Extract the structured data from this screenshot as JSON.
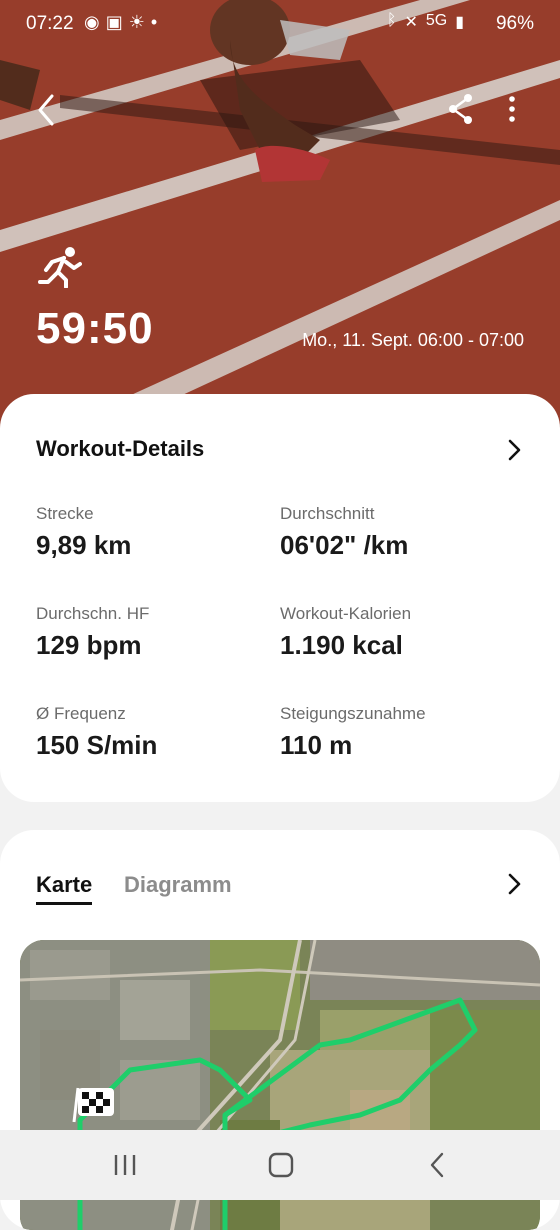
{
  "status_bar": {
    "time": "07:22",
    "battery": "96%",
    "left_icons": [
      "whatsapp-icon",
      "image-icon",
      "weather-icon",
      "dot-icon"
    ],
    "right_icons": [
      "bluetooth-icon",
      "mute-icon",
      "5g-icon",
      "signal-icon"
    ]
  },
  "hero": {
    "duration": "59:50",
    "datetime": "Mo., 11. Sept. 06:00 - 07:00"
  },
  "workout": {
    "title": "Workout-Details",
    "stats": [
      {
        "label": "Strecke",
        "value": "9,89 km"
      },
      {
        "label": "Durchschnitt",
        "value": "06'02\" /km"
      },
      {
        "label": "Durchschn. HF",
        "value": "129 bpm"
      },
      {
        "label": "Workout-Kalorien",
        "value": "1.190 kcal"
      },
      {
        "label": "Ø Frequenz",
        "value": "150 S/min"
      },
      {
        "label": "Steigungszunahme",
        "value": "110 m"
      }
    ]
  },
  "map_card": {
    "tabs": [
      "Karte",
      "Diagramm"
    ],
    "active_tab": "Karte",
    "route_color": "#1fce6a"
  },
  "colors": {
    "track": "#a4432f",
    "card_bg": "#ffffff",
    "page_bg": "#f2f2f2"
  }
}
